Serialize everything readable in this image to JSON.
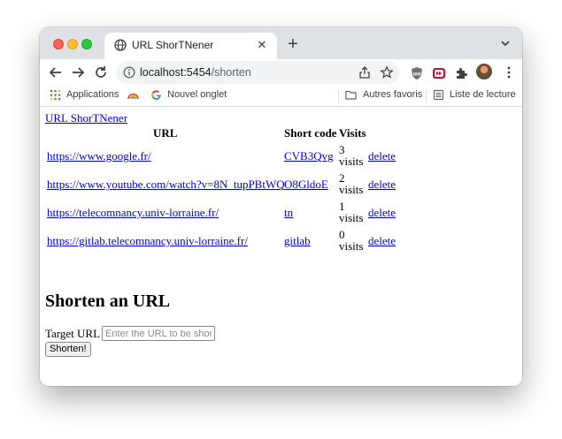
{
  "browser": {
    "tab_title": "URL ShorTNener",
    "url_host": "localhost:5454",
    "url_path": "/shorten"
  },
  "bookmarks": {
    "apps": "Applications",
    "new_tab": "Nouvel onglet",
    "other": "Autres favoris",
    "reading_list": "Liste de lecture"
  },
  "page": {
    "home_link": "URL ShorTNener",
    "table": {
      "headers": [
        "URL",
        "Short code",
        "Visits"
      ],
      "rows": [
        {
          "url": "https://www.google.fr/",
          "code": "CVB3Qvg",
          "visits_count": "3",
          "visits_unit": "visits",
          "action": "delete"
        },
        {
          "url": "https://www.youtube.com/watch?v=8N_tupPBtWQ",
          "code": "O8GldoE",
          "visits_count": "2",
          "visits_unit": "visits",
          "action": "delete"
        },
        {
          "url": "https://telecomnancy.univ-lorraine.fr/",
          "code": "tn",
          "visits_count": "1",
          "visits_unit": "visits",
          "action": "delete"
        },
        {
          "url": "https://gitlab.telecomnancy.univ-lorraine.fr/",
          "code": "gitlab",
          "visits_count": "0",
          "visits_unit": "visits",
          "action": "delete"
        }
      ]
    },
    "form": {
      "heading": "Shorten an URL",
      "label": "Target URL",
      "placeholder": "Enter the URL to be shortened",
      "value": "",
      "submit": "Shorten!"
    }
  }
}
